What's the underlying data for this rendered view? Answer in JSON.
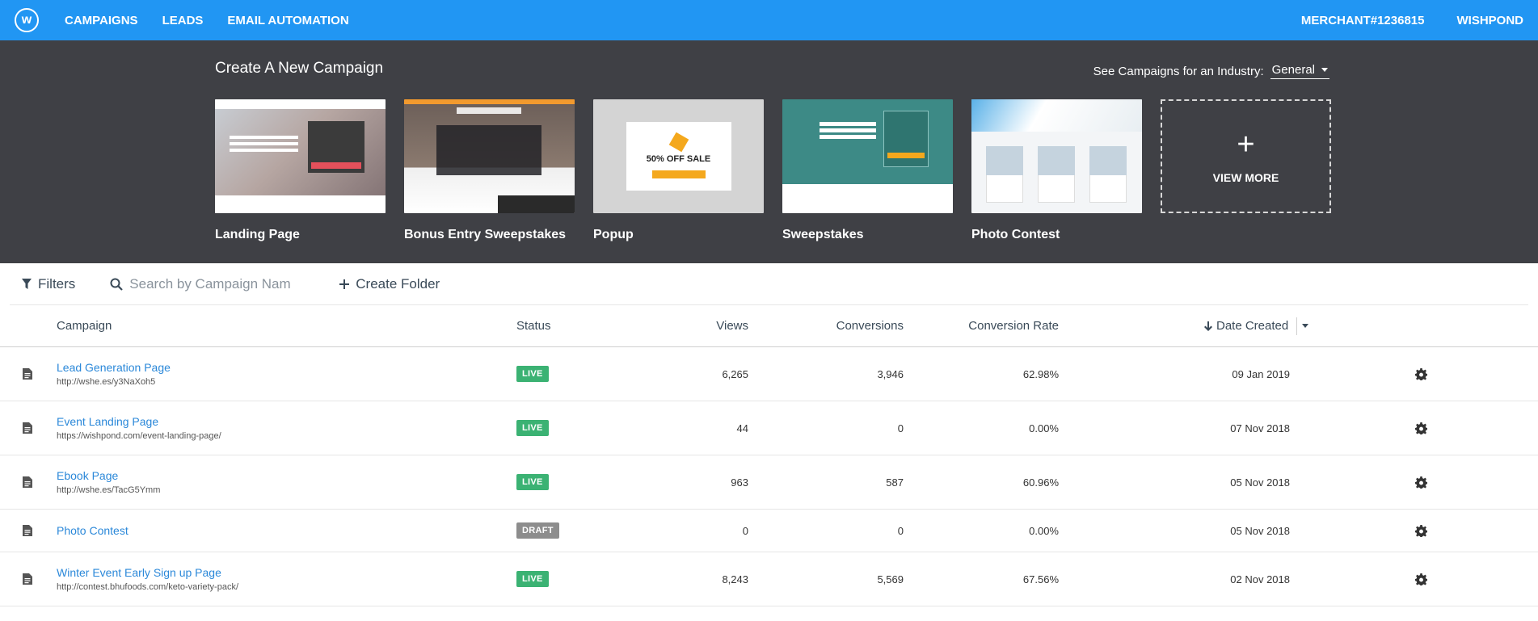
{
  "topbar": {
    "logo_letter": "w",
    "nav": [
      "CAMPAIGNS",
      "LEADS",
      "EMAIL AUTOMATION"
    ],
    "merchant": "MERCHANT#1236815",
    "account": "WISHPOND",
    "color": "#2196f3"
  },
  "hero": {
    "title": "Create A New Campaign",
    "industry_label": "See Campaigns for an Industry:",
    "industry_value": "General",
    "templates": [
      {
        "label": "Landing Page"
      },
      {
        "label": "Bonus Entry Sweepstakes"
      },
      {
        "label": "Popup",
        "sale_text": "50% OFF SALE"
      },
      {
        "label": "Sweepstakes"
      },
      {
        "label": "Photo Contest"
      }
    ],
    "view_more": "VIEW MORE"
  },
  "toolbar": {
    "filters": "Filters",
    "search_placeholder": "Search by Campaign Name",
    "create_folder": "Create Folder"
  },
  "table": {
    "headers": {
      "campaign": "Campaign",
      "status": "Status",
      "views": "Views",
      "conversions": "Conversions",
      "rate": "Conversion Rate",
      "date": "Date Created"
    },
    "rows": [
      {
        "name": "Lead Generation Page",
        "url": "http://wshe.es/y3NaXoh5",
        "status": "LIVE",
        "views": "6,265",
        "conversions": "3,946",
        "rate": "62.98%",
        "date": "09 Jan 2019"
      },
      {
        "name": "Event Landing Page",
        "url": "https://wishpond.com/event-landing-page/",
        "status": "LIVE",
        "views": "44",
        "conversions": "0",
        "rate": "0.00%",
        "date": "07 Nov 2018"
      },
      {
        "name": "Ebook Page",
        "url": "http://wshe.es/TacG5Ymm",
        "status": "LIVE",
        "views": "963",
        "conversions": "587",
        "rate": "60.96%",
        "date": "05 Nov 2018"
      },
      {
        "name": "Photo Contest",
        "url": "",
        "status": "DRAFT",
        "views": "0",
        "conversions": "0",
        "rate": "0.00%",
        "date": "05 Nov 2018"
      },
      {
        "name": "Winter Event Early Sign up Page",
        "url": "http://contest.bhufoods.com/keto-variety-pack/",
        "status": "LIVE",
        "views": "8,243",
        "conversions": "5,569",
        "rate": "67.56%",
        "date": "02 Nov 2018"
      }
    ]
  }
}
